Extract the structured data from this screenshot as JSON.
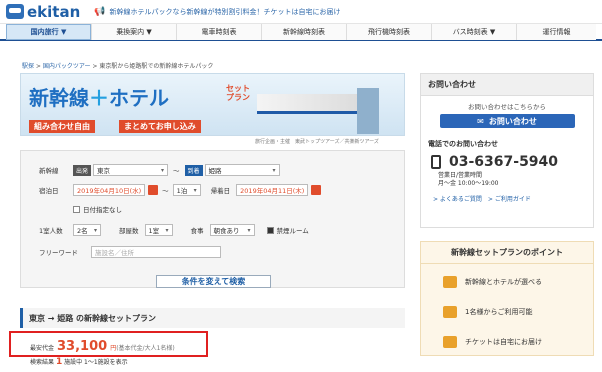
{
  "header": {
    "logo_text": "ekitan",
    "promo": "新幹線ホテルパックなら新幹線が特別割引料金！チケットは自宅にお届け"
  },
  "nav": {
    "items": [
      {
        "label": "国内旅行 ▼",
        "active": true
      },
      {
        "label": "乗換案内 ▼"
      },
      {
        "label": "電車時刻表"
      },
      {
        "label": "新幹線時刻表"
      },
      {
        "label": "飛行機時刻表"
      },
      {
        "label": "バス時刻表 ▼"
      },
      {
        "label": "運行情報"
      }
    ]
  },
  "breadcrumb": {
    "a": "駅探",
    "b": "国内パックツアー",
    "c": "東京駅から姫路駅での新幹線ホテルパック"
  },
  "banner": {
    "title_a": "新幹線",
    "title_plus": "＋",
    "title_b": "ホテル",
    "setplan_1": "セット",
    "setplan_2": "プラン",
    "tag1": "組み合わせ自由",
    "tag2": "まとめてお申し込み",
    "sponsor": "旅行企画・主催　東武トップツアーズ／共楽新ツアーズ"
  },
  "form": {
    "departure_label": "新幹線",
    "dep_tag": "出発",
    "dep_value": "東京",
    "arr_tag": "到着",
    "arr_value": "姫路",
    "checkin_label": "宿泊日",
    "checkin_date": "2019年04月10日(水)",
    "nights": "1泊",
    "return_label": "帰着日",
    "return_date": "2019年04月11日(木)",
    "date_undecided": "日付指定なし",
    "guests_label": "1室人数",
    "guests": "2名",
    "rooms_label": "部屋数",
    "rooms": "1室",
    "meal_label": "食事",
    "meal": "朝食あり",
    "nonsmoking": "禁煙ルーム",
    "freeword_label": "フリーワード",
    "freeword_placeholder": "施設名／住所",
    "submit": "条件を変えて検索"
  },
  "result": {
    "heading": "東京 → 姫路 の新幹線セットプラン",
    "price_label": "最安代金",
    "price": "33,100",
    "price_unit": "円",
    "price_note": "(基本代金/大人1名様)",
    "hits_label": "検索結果",
    "hits_num": "1",
    "hits_text": "施設中 1〜1施設を表示"
  },
  "sidebar": {
    "contact_title": "お問い合わせ",
    "contact_small": "お問い合わせはこちらから",
    "contact_btn": "お問い合わせ",
    "tel_heading": "電話でのお問い合わせ",
    "tel": "03-6367-5940",
    "hours_label": "営業日/営業時間",
    "hours": "月～金 10:00～19:00",
    "links": "> よくあるご質問　> ご利用ガイド",
    "points_title": "新幹線セットプランのポイント",
    "points": [
      {
        "text": "新幹線とホテルが選べる"
      },
      {
        "text": "1名様からご利用可能"
      },
      {
        "text": "チケットは自宅にお届け"
      }
    ]
  }
}
